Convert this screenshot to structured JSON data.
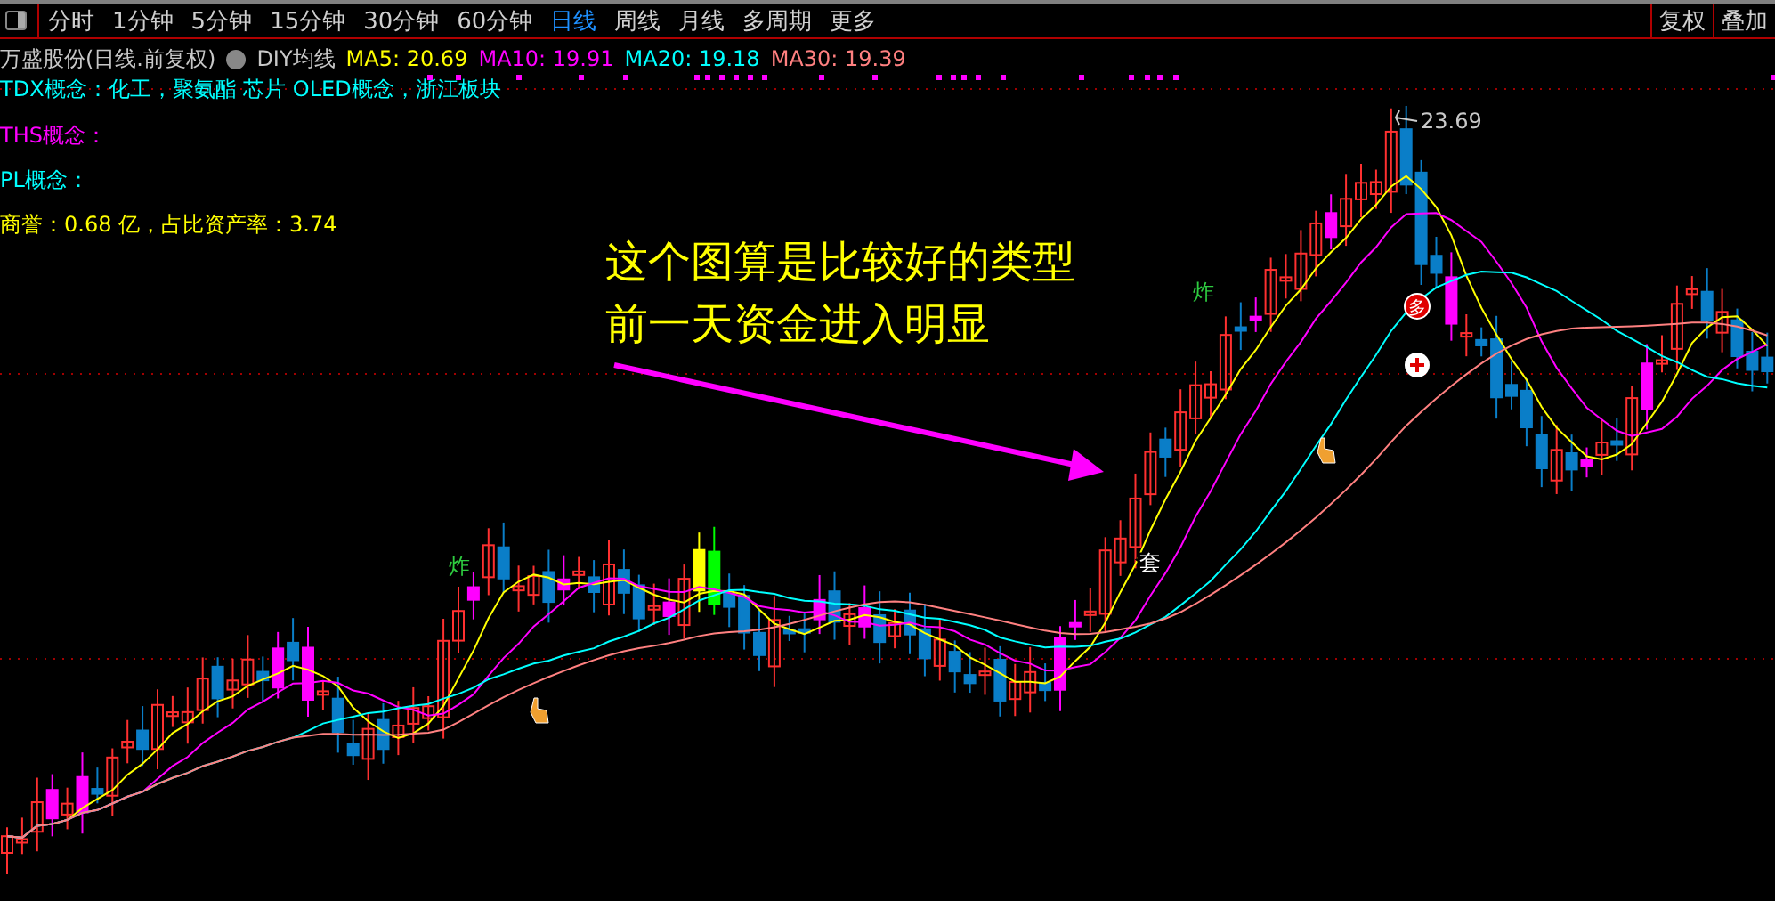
{
  "toolbar": {
    "items": [
      {
        "label": "分时",
        "selected": false
      },
      {
        "label": "1分钟",
        "selected": false
      },
      {
        "label": "5分钟",
        "selected": false
      },
      {
        "label": "15分钟",
        "selected": false
      },
      {
        "label": "30分钟",
        "selected": false
      },
      {
        "label": "60分钟",
        "selected": false
      },
      {
        "label": "日线",
        "selected": true
      },
      {
        "label": "周线",
        "selected": false
      },
      {
        "label": "月线",
        "selected": false
      },
      {
        "label": "多周期",
        "selected": false
      },
      {
        "label": "更多",
        "selected": false
      }
    ],
    "right_buttons": [
      "复权",
      "叠加"
    ]
  },
  "header": {
    "stock": "万盛股份(日线.前复权)",
    "indicator": "DIY均线",
    "ma": [
      {
        "label": "MA5: 20.69",
        "color": "#ffff00"
      },
      {
        "label": "MA10: 19.91",
        "color": "#ff00ff"
      },
      {
        "label": "MA20: 19.18",
        "color": "#00ffff"
      },
      {
        "label": "MA30: 19.39",
        "color": "#ff8080"
      }
    ]
  },
  "concept_line": {
    "text": "TDX概念：化工，聚氨酯 芯片 OLED概念，浙江板块",
    "color": "#00ffff"
  },
  "info_lines": [
    {
      "text": "THS概念：",
      "color": "#ff00ff"
    },
    {
      "text": "PL概念：",
      "color": "#00ffff"
    },
    {
      "text": "商誉：0.68 亿，占比资产率：3.74",
      "color": "#ffff00"
    }
  ],
  "annotation": [
    "这个图算是比较好的类型",
    "前一天资金进入明显"
  ],
  "chart": {
    "high_label": "23.69",
    "markers": [
      {
        "kind": "zha",
        "text": "炸"
      },
      {
        "kind": "zha",
        "text": "炸"
      },
      {
        "kind": "tao",
        "text": "套"
      },
      {
        "kind": "duo",
        "text": "多"
      }
    ]
  }
}
